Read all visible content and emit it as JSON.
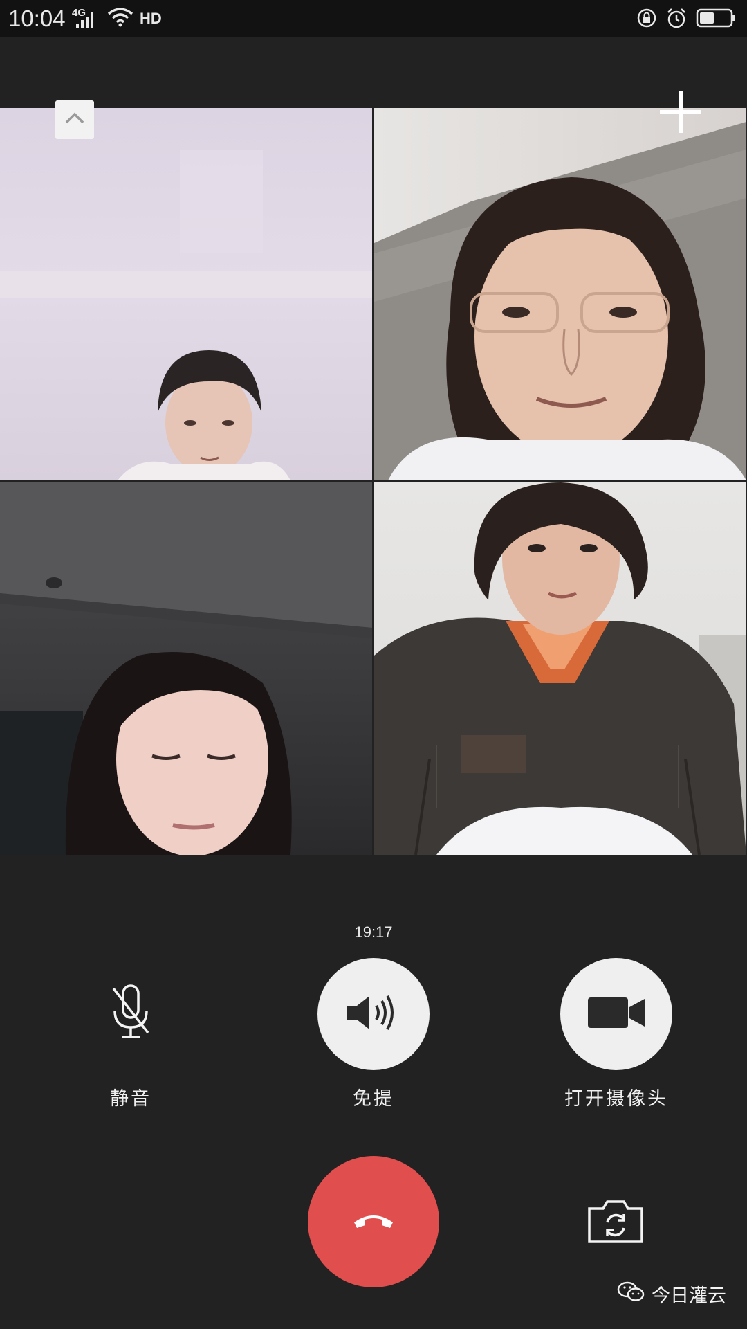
{
  "status_bar": {
    "time": "10:04",
    "network": "4G",
    "hd": "HD",
    "icons": [
      "signal-icon",
      "wifi-icon",
      "hd-icon",
      "lock-rotation-icon",
      "alarm-icon",
      "battery-icon"
    ]
  },
  "call": {
    "duration": "19:17",
    "participants": [
      {
        "tile": 1,
        "description_icon": "participant-video"
      },
      {
        "tile": 2,
        "description_icon": "participant-video"
      },
      {
        "tile": 3,
        "description_icon": "participant-video"
      },
      {
        "tile": 4,
        "description_icon": "participant-video"
      }
    ]
  },
  "controls": {
    "mute_label": "静音",
    "speaker_label": "免提",
    "camera_label": "打开摄像头"
  },
  "watermark": {
    "text": "今日灌云"
  },
  "colors": {
    "background": "#232223",
    "hangup": "#e04e4e",
    "button": "#efefef"
  }
}
